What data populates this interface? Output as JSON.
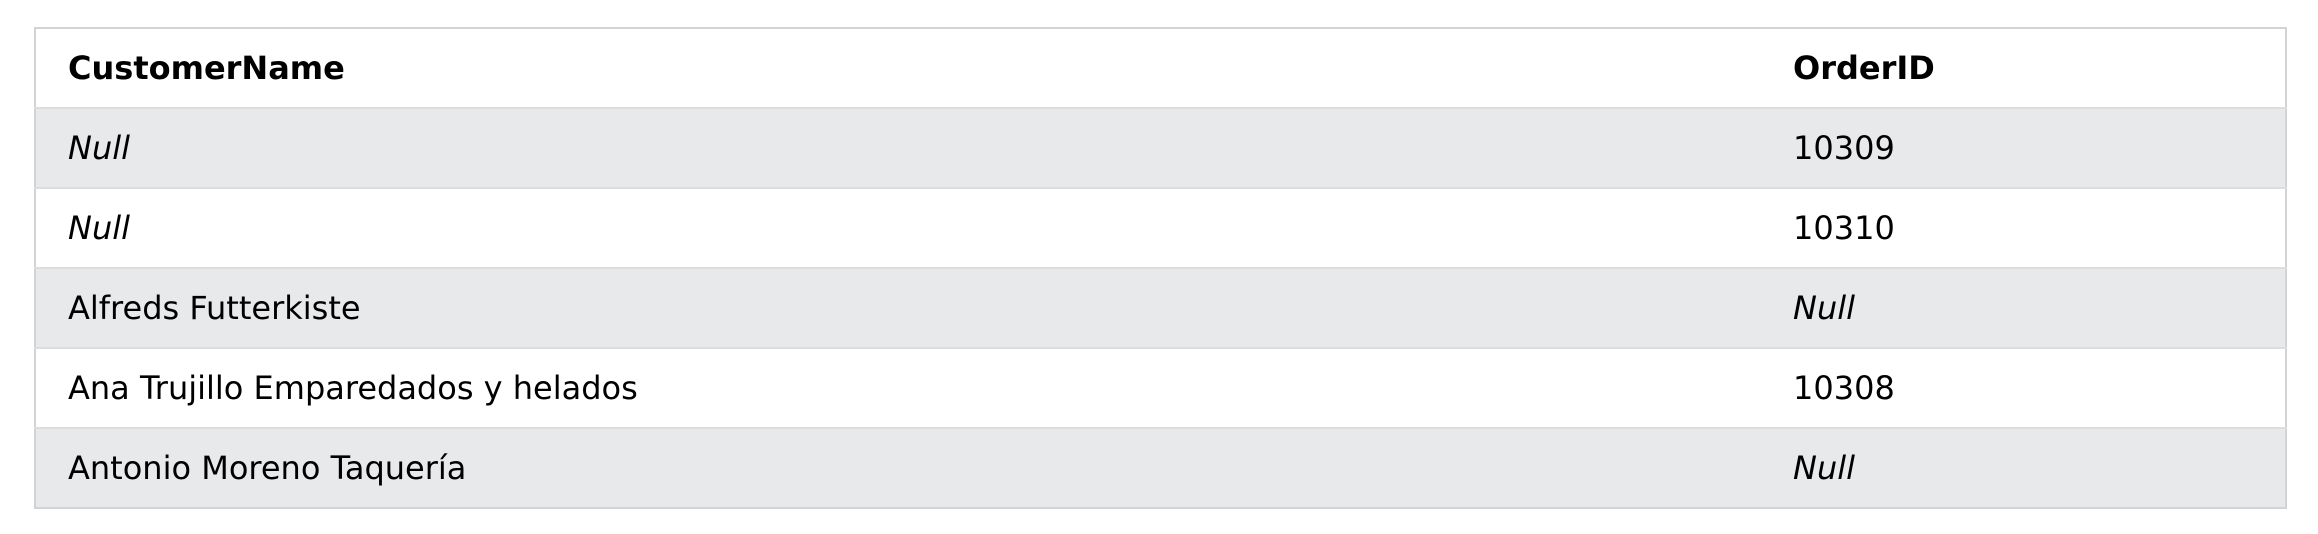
{
  "table": {
    "headers": [
      "CustomerName",
      "OrderID"
    ],
    "rows": [
      {
        "customer_name": "Null",
        "customer_name_null": true,
        "order_id": "10309",
        "order_id_null": false
      },
      {
        "customer_name": "Null",
        "customer_name_null": true,
        "order_id": "10310",
        "order_id_null": false
      },
      {
        "customer_name": "Alfreds Futterkiste",
        "customer_name_null": false,
        "order_id": "Null",
        "order_id_null": true
      },
      {
        "customer_name": "Ana Trujillo Emparedados y helados",
        "customer_name_null": false,
        "order_id": "10308",
        "order_id_null": false
      },
      {
        "customer_name": "Antonio Moreno Taquería",
        "customer_name_null": false,
        "order_id": "Null",
        "order_id_null": true
      }
    ]
  },
  "colors": {
    "row_stripe": "#e7e9eb",
    "border": "#d3d3d3"
  }
}
